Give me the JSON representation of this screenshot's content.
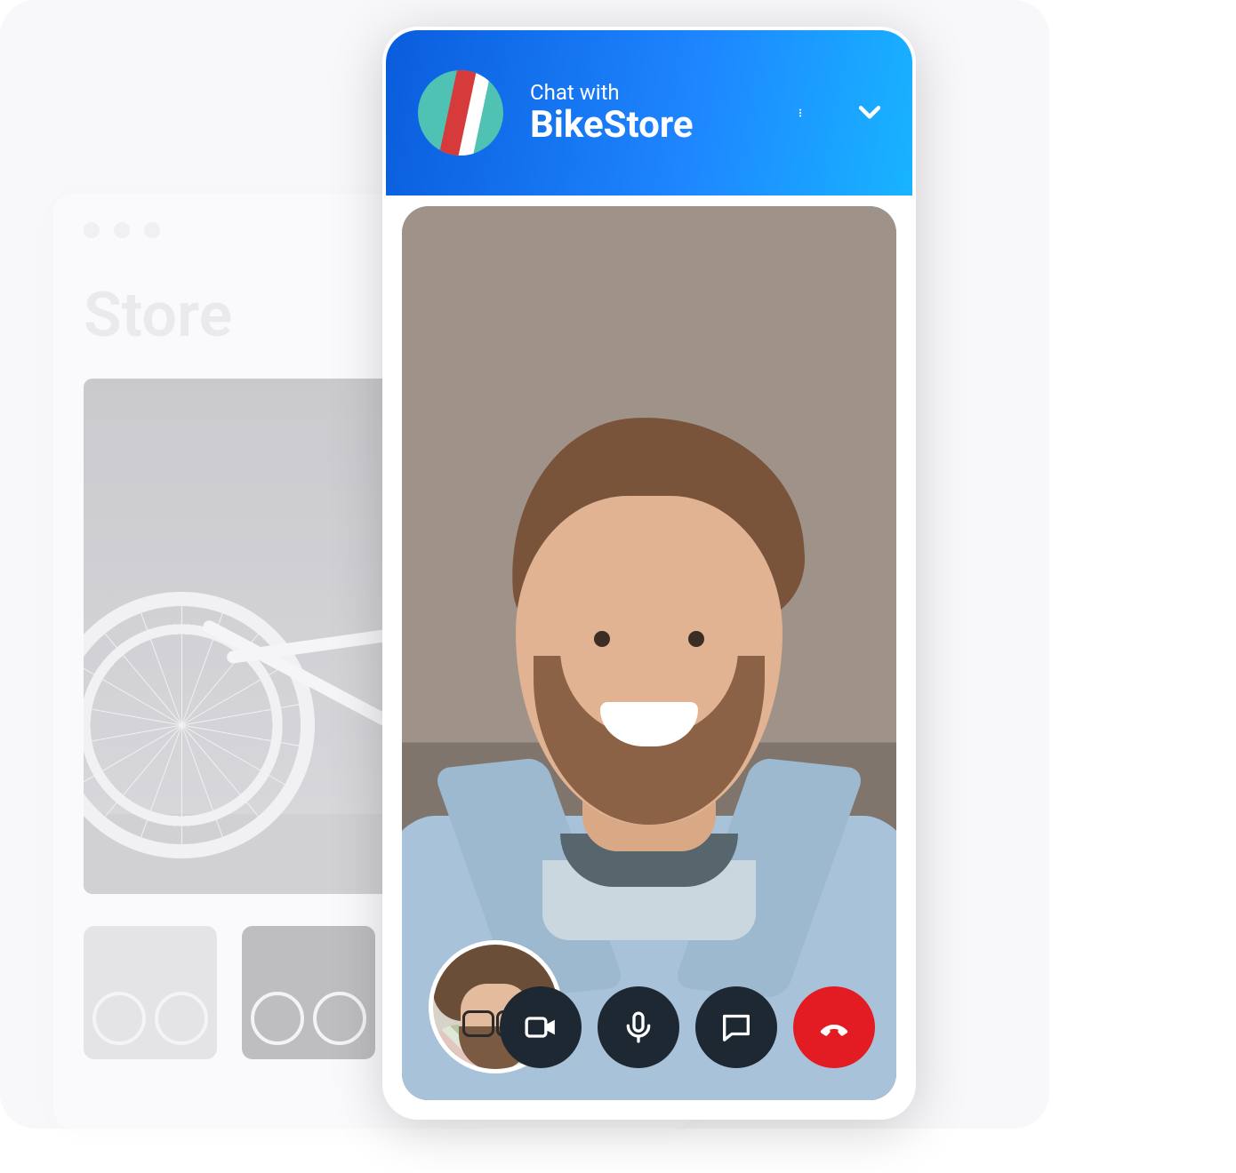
{
  "store": {
    "title": "Store"
  },
  "chat": {
    "header": {
      "subtitle": "Chat with",
      "title": "BikeStore"
    },
    "controls": {
      "video_icon": "video-icon",
      "mic_icon": "mic-icon",
      "chat_icon": "chat-icon",
      "hangup_icon": "hangup-icon"
    },
    "colors": {
      "header_gradient_start": "#0a5ddc",
      "header_gradient_end": "#18b4ff",
      "hangup": "#e31b23",
      "control_dark": "#1e2833"
    }
  }
}
